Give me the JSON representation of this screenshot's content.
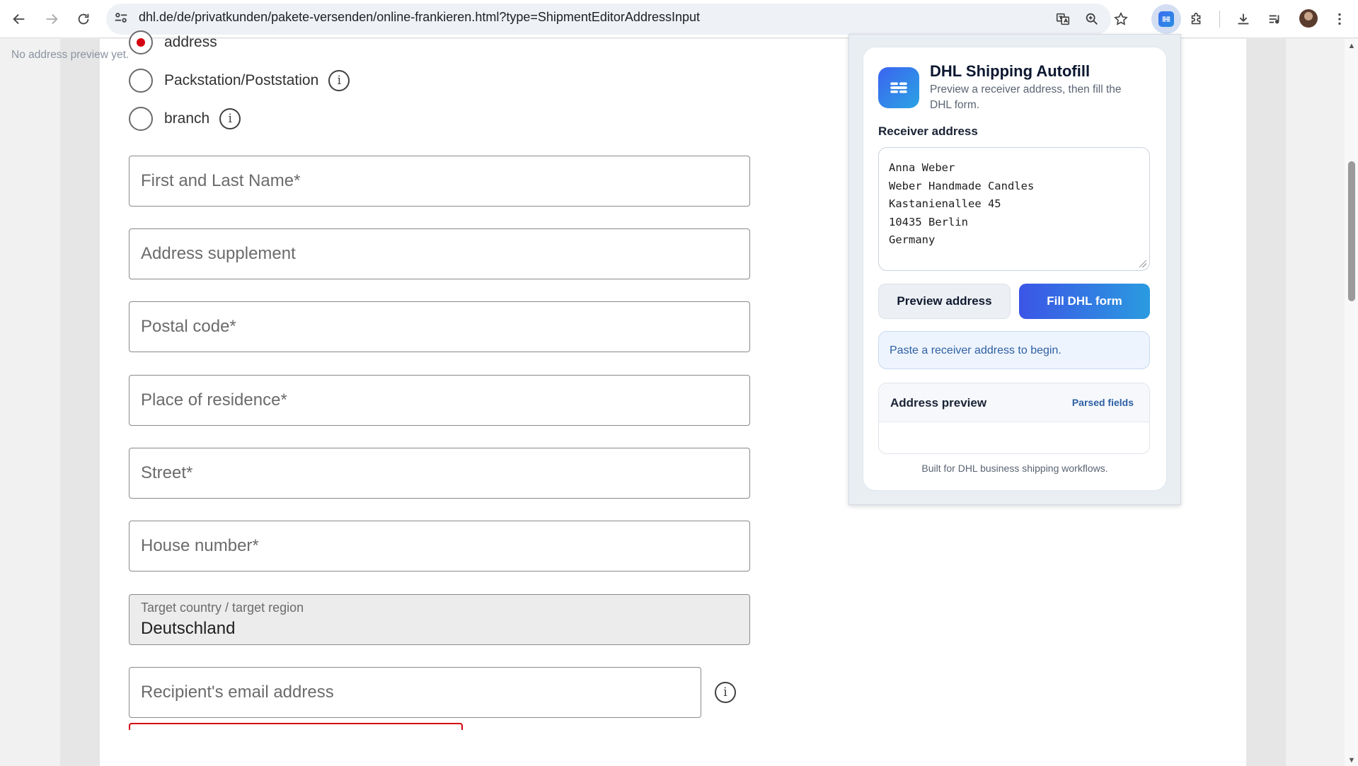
{
  "browser": {
    "url": "dhl.de/de/privatkunden/pakete-versenden/online-frankieren.html?type=ShipmentEditorAddressInput",
    "icons": [
      "back-icon",
      "forward-icon",
      "reload-icon",
      "site-settings-icon",
      "translate-icon",
      "zoom-icon",
      "bookmark-star-icon",
      "extension-icon",
      "puzzle-icon",
      "download-icon",
      "media-icon",
      "avatar",
      "menu-icon"
    ]
  },
  "form": {
    "delivery_options": [
      {
        "label": "address",
        "checked": true
      },
      {
        "label": "Packstation/Poststation",
        "checked": false
      },
      {
        "label": "branch",
        "checked": false
      }
    ],
    "fields": {
      "name": "First and Last Name*",
      "supplement": "Address supplement",
      "postal_code": "Postal code*",
      "city": "Place of residence*",
      "street": "Street*",
      "house_number": "House number*",
      "email": "Recipient's email address"
    },
    "country": {
      "label": "Target country / target region",
      "value": "Deutschland"
    }
  },
  "popup": {
    "title": "DHL Shipping Autofill",
    "subtitle": "Preview a receiver address, then fill the DHL form.",
    "receiver_label": "Receiver address",
    "receiver_value": "Anna Weber\nWeber Handmade Candles\nKastanienallee 45\n10435 Berlin\nGermany",
    "preview_button": "Preview address",
    "fill_button": "Fill DHL form",
    "status": "Paste a receiver address to begin.",
    "preview_title": "Address preview",
    "preview_tag": "Parsed fields",
    "preview_empty": "No address preview yet.",
    "footer": "Built for DHL business shipping workflows.",
    "accent_color": "#3b55e6"
  },
  "colors": {
    "dhl_red": "#d40511",
    "toolbar_bg": "#ffffff",
    "omnibox_bg": "#eef1f6"
  }
}
